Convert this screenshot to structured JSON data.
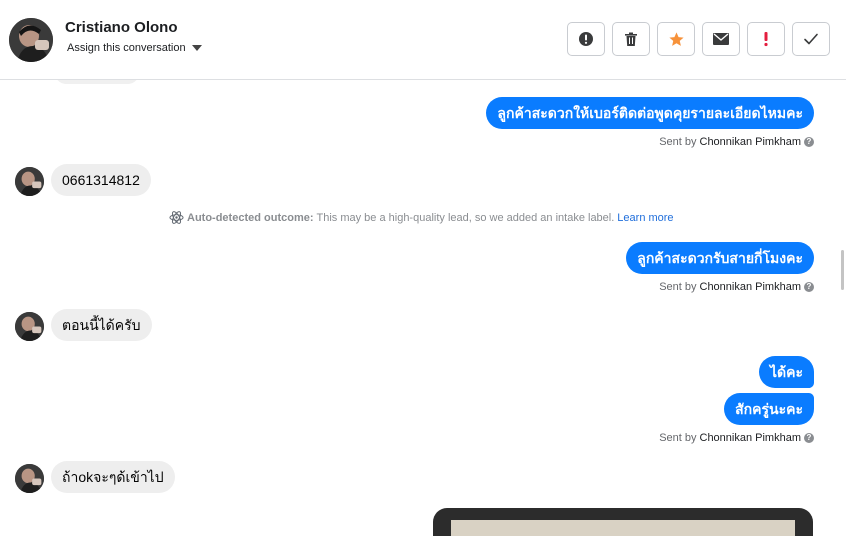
{
  "header": {
    "contact_name": "Cristiano Olono",
    "assign_label": "Assign this conversation",
    "actions": [
      {
        "name": "alert-button",
        "icon": "exclamation-circle-icon"
      },
      {
        "name": "delete-button",
        "icon": "trash-icon"
      },
      {
        "name": "star-button",
        "icon": "star-icon"
      },
      {
        "name": "mark-unread-button",
        "icon": "envelope-icon"
      },
      {
        "name": "spam-button",
        "icon": "exclamation-icon"
      },
      {
        "name": "done-button",
        "icon": "checkmark-icon"
      }
    ]
  },
  "messages": {
    "m1": {
      "text": "ลูกค้าสะดวกให้เบอร์ติดต่อพูดคุยรายละเอียดไหมคะ"
    },
    "sent_prefix": "Sent by",
    "agent_name": "Chonnikan Pimkham",
    "m2": {
      "text": "0661314812"
    },
    "auto": {
      "label": "Auto-detected outcome:",
      "text": "This may be a high-quality lead, so we added an intake label.",
      "link": "Learn more"
    },
    "m3": {
      "text": "ลูกค้าสะดวกรับสายกี่โมงคะ"
    },
    "m4": {
      "text": "ตอนนี้ได้ครับ"
    },
    "m5": {
      "text": "ได้คะ"
    },
    "m6": {
      "text": "สักครู่นะคะ"
    },
    "m7": {
      "text": "ถ้าokจะๆด้เข้าไป"
    }
  },
  "colors": {
    "accent": "#0a7cff",
    "incoming_bubble": "#eeeeee",
    "star": "#f7923a",
    "spam": "#e41e3f"
  }
}
